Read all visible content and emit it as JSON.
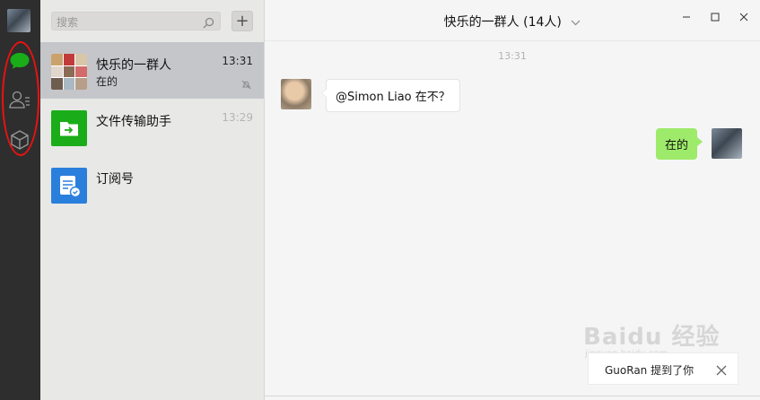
{
  "search": {
    "placeholder": "搜索"
  },
  "toolbar": {
    "add_label": "+"
  },
  "conversations": [
    {
      "name": "快乐的一群人",
      "preview": "在的",
      "time": "13:31"
    },
    {
      "name": "文件传输助手",
      "preview": "",
      "time": "13:29"
    },
    {
      "name": "订阅号",
      "preview": "",
      "time": ""
    }
  ],
  "chat": {
    "title": "快乐的一群人 (14人)",
    "timestamp": "13:31",
    "messages": [
      {
        "side": "left",
        "text": "@Simon Liao 在不？"
      },
      {
        "side": "right",
        "text": "在的"
      }
    ],
    "mention_notice": "GuoRan 提到了你"
  },
  "watermark": {
    "brand": "Baidu 经验",
    "url": "jingyan.baidu.com"
  },
  "colors": {
    "rail_bg": "#2e2e2e",
    "accent_green": "#1aad19",
    "bubble_green": "#9eea6a",
    "active_row": "#c5c6c9",
    "annotation_red": "#ee1111"
  },
  "icons": [
    "chat-icon",
    "contacts-icon",
    "favorites-icon",
    "search-icon",
    "mute-icon",
    "chevron-down-icon",
    "minimize-icon",
    "maximize-icon",
    "close-icon"
  ]
}
